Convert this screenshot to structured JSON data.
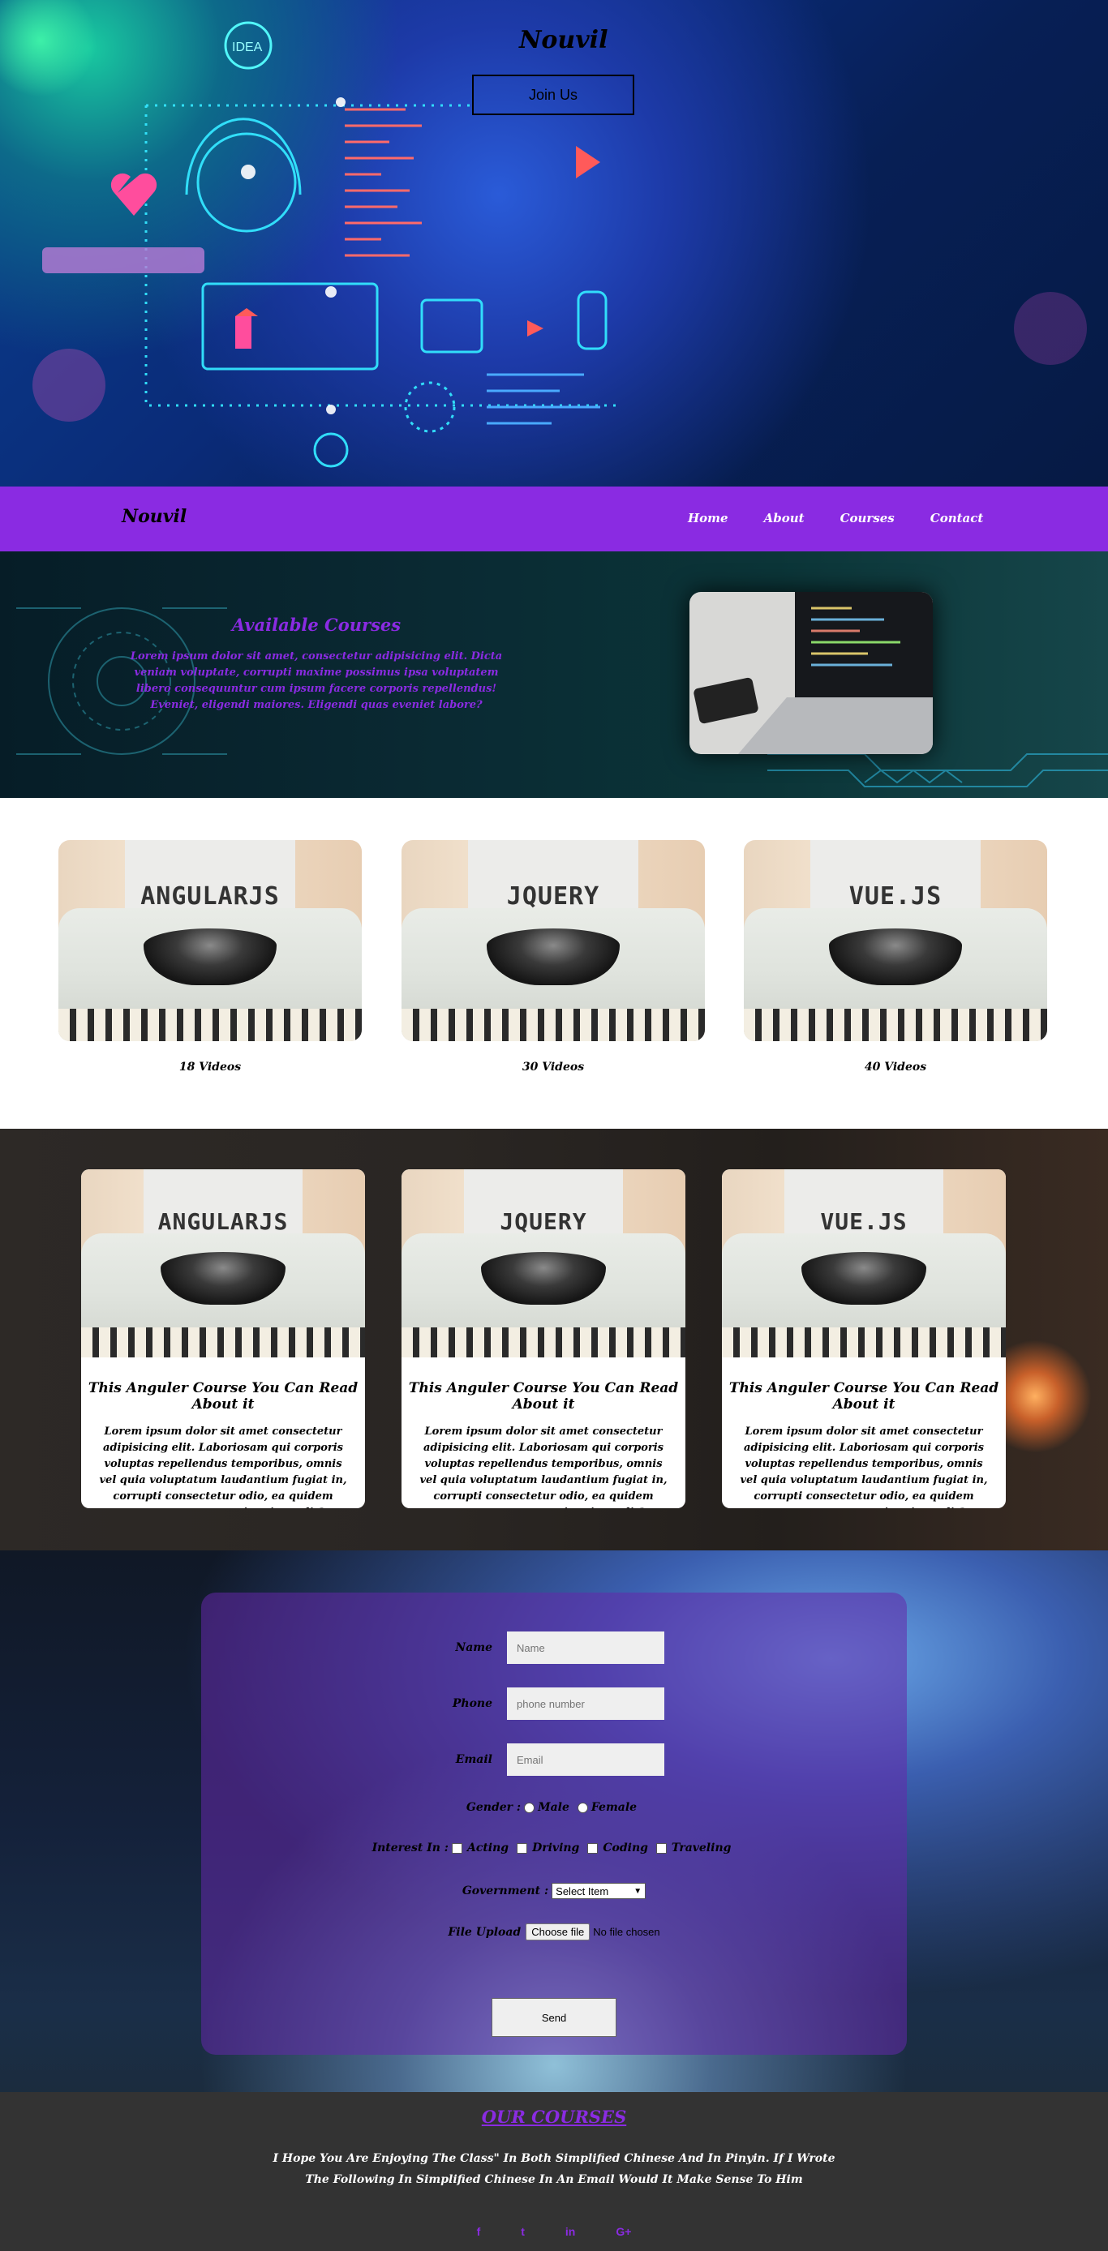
{
  "hero": {
    "title": "Nouvil",
    "join_label": "Join Us"
  },
  "nav": {
    "logo": "Nouvil",
    "links": [
      "Home",
      "About",
      "Courses",
      "Contact"
    ]
  },
  "banner": {
    "title": "Available Courses",
    "text": "Lorem ipsum dolor sit amet, consectetur adipisicing elit. Dicta veniam voluptate, corrupti maxime possimus ipsa voluptatem libero consequuntur cum ipsum facere corporis repellendus! Eveniet, eligendi maiores. Eligendi quas eveniet labore?"
  },
  "videos": [
    {
      "course": "ANGULARJS",
      "count": "18 Videos"
    },
    {
      "course": "JQUERY",
      "count": "30 Videos"
    },
    {
      "course": "VUE.JS",
      "count": "40 Videos"
    }
  ],
  "courses": [
    {
      "course": "ANGULARJS",
      "title": "This Anguler Course You Can Read About it",
      "text": "Lorem ipsum dolor sit amet consectetur adipisicing elit. Laboriosam qui corporis voluptas repellendus temporibus, omnis vel quia voluptatum laudantium fugiat in, corrupti consectetur odio, ea quidem aspernatur accusantium iste odit?"
    },
    {
      "course": "JQUERY",
      "title": "This Anguler Course You Can Read About it",
      "text": "Lorem ipsum dolor sit amet consectetur adipisicing elit. Laboriosam qui corporis voluptas repellendus temporibus, omnis vel quia voluptatum laudantium fugiat in, corrupti consectetur odio, ea quidem aspernatur accusantium iste odit?"
    },
    {
      "course": "VUE.JS",
      "title": "This Anguler Course You Can Read About it",
      "text": "Lorem ipsum dolor sit amet consectetur adipisicing elit. Laboriosam qui corporis voluptas repellendus temporibus, omnis vel quia voluptatum laudantium fugiat in, corrupti consectetur odio, ea quidem aspernatur accusantium iste odit?"
    }
  ],
  "form": {
    "name_label": "Name",
    "name_placeholder": "Name",
    "phone_label": "Phone",
    "phone_placeholder": "phone number",
    "email_label": "Email",
    "email_placeholder": "Email",
    "gender_label": "Gender :",
    "gender_options": [
      "Male",
      "Female"
    ],
    "interest_label": "Interest In :",
    "interest_options": [
      "Acting",
      "Driving",
      "Coding",
      "Traveling"
    ],
    "government_label": "Government :",
    "government_selected": "Select Item",
    "file_label": "File Upload",
    "file_button": "Choose file",
    "file_status": "No file chosen",
    "send_label": "Send"
  },
  "footer": {
    "title": "OUR COURSES",
    "text": "I Hope You Are Enjoying The Class\" In Both Simplified Chinese And In Pinyin. If I Wrote The Following In Simplified Chinese In An Email Would It Make Sense To Him",
    "socials": [
      "f",
      "t",
      "in",
      "G+"
    ]
  },
  "colors": {
    "accent": "#8a2be2",
    "footer_bg": "#333333",
    "hero_bg": "#0a2b78"
  }
}
